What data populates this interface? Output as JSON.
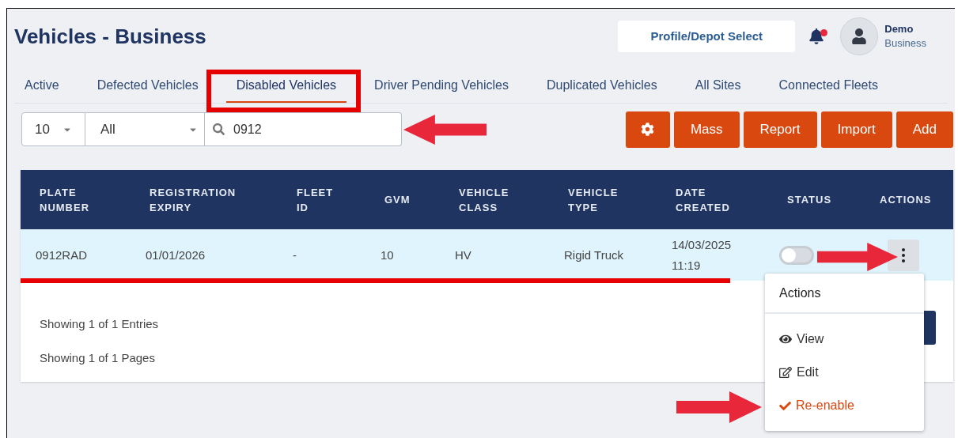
{
  "page": {
    "title": "Vehicles - Business"
  },
  "header": {
    "profile_button": "Profile/Depot Select",
    "notifications": {
      "unread": true
    },
    "user": {
      "name": "Demo",
      "role": "Business"
    }
  },
  "tabs": [
    {
      "label": "Active",
      "selected": false
    },
    {
      "label": "Defected Vehicles",
      "selected": false
    },
    {
      "label": "Disabled Vehicles",
      "selected": true
    },
    {
      "label": "Driver Pending Vehicles",
      "selected": false
    },
    {
      "label": "Duplicated Vehicles",
      "selected": false
    },
    {
      "label": "All Sites",
      "selected": false
    },
    {
      "label": "Connected Fleets",
      "selected": false
    }
  ],
  "filters": {
    "page_size": "10",
    "category": "All",
    "search": {
      "value": "0912"
    }
  },
  "toolbar_buttons": [
    {
      "kind": "settings"
    },
    {
      "kind": "text",
      "label": "Mass"
    },
    {
      "kind": "text",
      "label": "Report"
    },
    {
      "kind": "text",
      "label": "Import"
    },
    {
      "kind": "text",
      "label": "Add"
    }
  ],
  "table": {
    "columns": [
      "PLATE NUMBER",
      "REGISTRATION EXPIRY",
      "FLEET ID",
      "GVM",
      "VEHICLE CLASS",
      "VEHICLE TYPE",
      "DATE CREATED",
      "STATUS",
      "ACTIONS"
    ],
    "rows": [
      {
        "cells": [
          "0912RAD",
          "01/01/2026",
          "-",
          "10",
          "HV",
          "Rigid Truck",
          "14/03/2025 11:19"
        ],
        "status_on": false,
        "highlighted": true
      }
    ]
  },
  "footer": {
    "entries": "Showing 1 of 1 Entries",
    "pages": "Showing 1 of 1 Pages"
  },
  "actions_menu": {
    "open": true,
    "title": "Actions",
    "items": [
      {
        "kind": "view",
        "label": "View"
      },
      {
        "kind": "edit",
        "label": "Edit"
      },
      {
        "kind": "reenable",
        "label": "Re-enable"
      }
    ]
  }
}
